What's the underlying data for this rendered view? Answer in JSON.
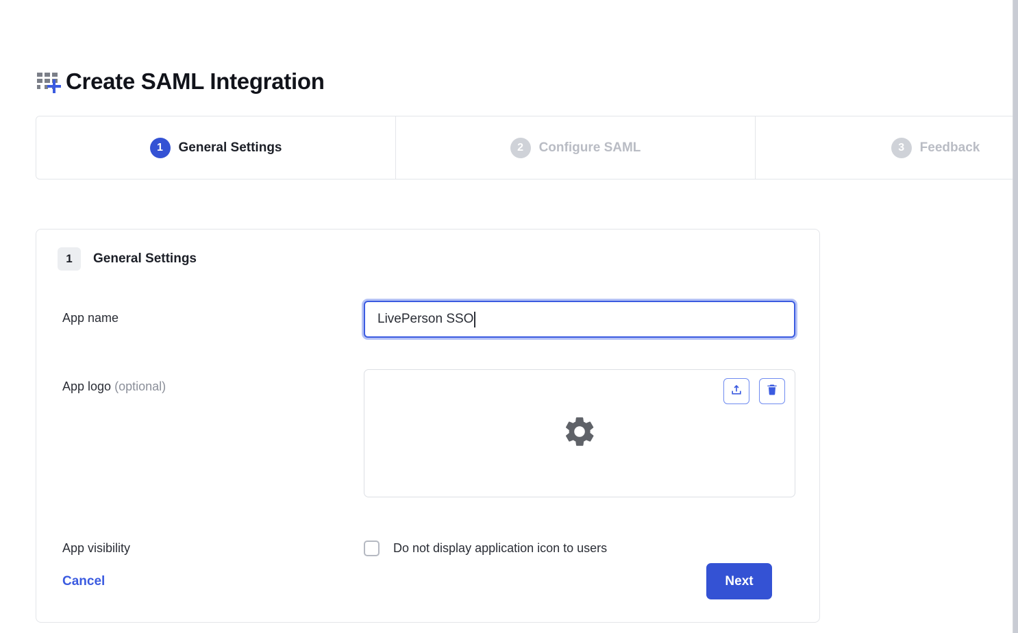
{
  "page": {
    "title": "Create SAML Integration",
    "title_icon": "grid-plus-icon"
  },
  "stepper": {
    "steps": [
      {
        "number": "1",
        "label": "General Settings",
        "state": "active"
      },
      {
        "number": "2",
        "label": "Configure SAML",
        "state": "inactive"
      },
      {
        "number": "3",
        "label": "Feedback",
        "state": "inactive"
      }
    ]
  },
  "card": {
    "section_number": "1",
    "section_title": "General Settings",
    "fields": {
      "app_name": {
        "label": "App name",
        "value": "LivePerson SSO",
        "placeholder": ""
      },
      "app_logo": {
        "label": "App logo",
        "label_suffix": "(optional)",
        "placeholder_icon": "gear-icon",
        "upload_icon": "upload-icon",
        "delete_icon": "trash-icon"
      },
      "app_visibility": {
        "label": "App visibility",
        "checkbox_label": "Do not display application icon to users",
        "checked": false
      }
    },
    "footer": {
      "cancel_label": "Cancel",
      "next_label": "Next"
    }
  },
  "colors": {
    "accent_blue": "#3452d4",
    "link_blue": "#3b5be0",
    "border_gray": "#e3e5e9",
    "muted_text": "#b9bcc4",
    "badge_gray": "#cfd2d8"
  }
}
